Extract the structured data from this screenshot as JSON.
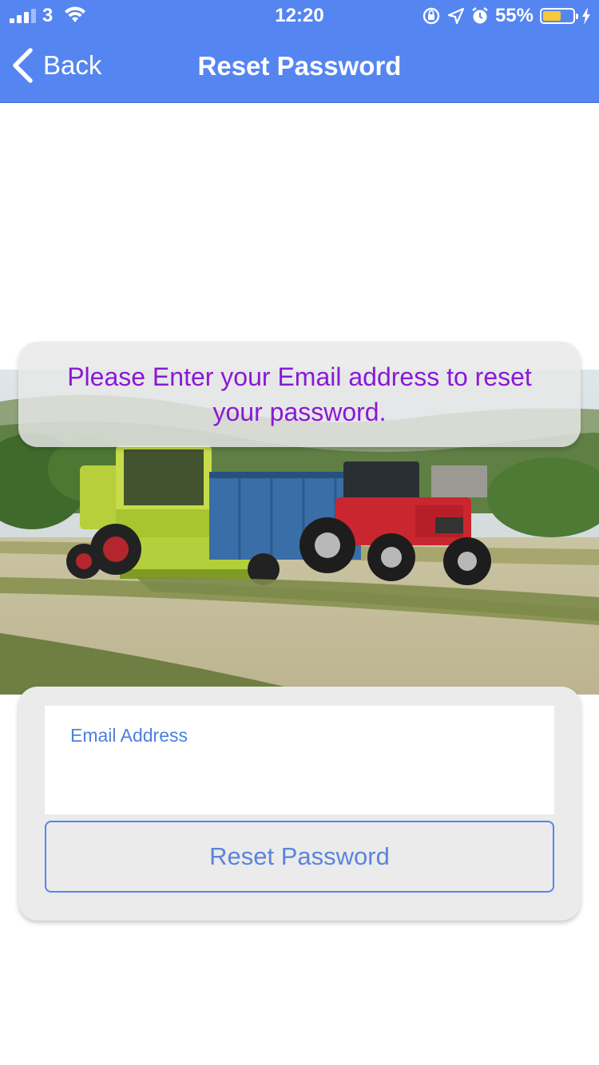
{
  "status_bar": {
    "carrier": "3",
    "time": "12:20",
    "battery_percent": "55%"
  },
  "nav": {
    "back_label": "Back",
    "title": "Reset Password"
  },
  "message": "Please Enter your Email address to reset your password.",
  "form": {
    "email_label": "Email Address",
    "email_value": "",
    "reset_button_label": "Reset Password"
  },
  "colors": {
    "brand_blue": "#5585f0",
    "message_purple": "#8a18d8",
    "card_grey": "#ebebeb"
  }
}
